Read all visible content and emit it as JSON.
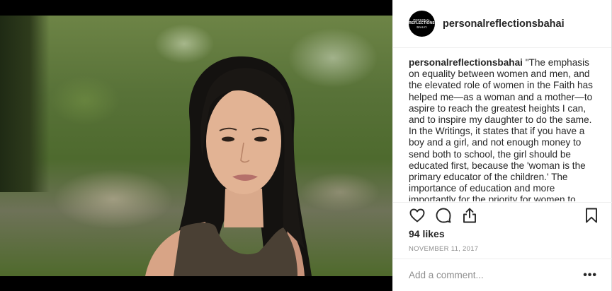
{
  "post": {
    "username": "personalreflectionsbahai",
    "avatar_text_top": "PERSONAL",
    "avatar_text_mid": "REFLECTIONS",
    "avatar_text_bottom": "BAHA'I",
    "caption_text": "\"The emphasis on equality between women and men, and the elevated role of women in the Faith has helped me—as a woman and a mother—to aspire to reach the greatest heights I can, and to inspire my daughter to do the same. In the Writings, it states that if you have a boy and a girl, and not enough money to send both to school, the girl should be educated first, because the 'woman is the primary educator of the children.' The importance of education and more importantly for the priority for women to",
    "likes": "94 likes",
    "date": "NOVEMBER 11, 2017",
    "comment_placeholder": "Add a comment...",
    "more_label": "•••"
  },
  "icons": [
    "heart-icon",
    "comment-icon",
    "share-icon",
    "bookmark-icon"
  ],
  "colors": {
    "text": "#262626",
    "muted": "#8e8e8e",
    "border": "#efefef"
  }
}
